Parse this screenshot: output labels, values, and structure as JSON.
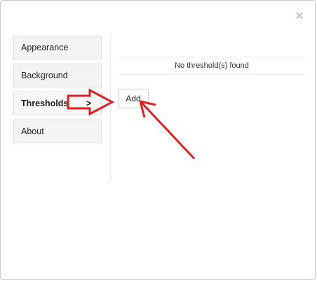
{
  "dialog": {
    "close_symbol": "×"
  },
  "sidebar": {
    "items": [
      {
        "label": "Appearance",
        "active": false
      },
      {
        "label": "Background",
        "active": false
      },
      {
        "label": "Thresholds",
        "active": true,
        "indicator": ">"
      },
      {
        "label": "About",
        "active": false
      }
    ]
  },
  "thresholds": {
    "empty_message": "No threshold(s) found",
    "add_label": "Add"
  },
  "annotations": {
    "color": "#e02020",
    "items": [
      "right-arrow-icon",
      "pointer-arrow-icon"
    ]
  }
}
